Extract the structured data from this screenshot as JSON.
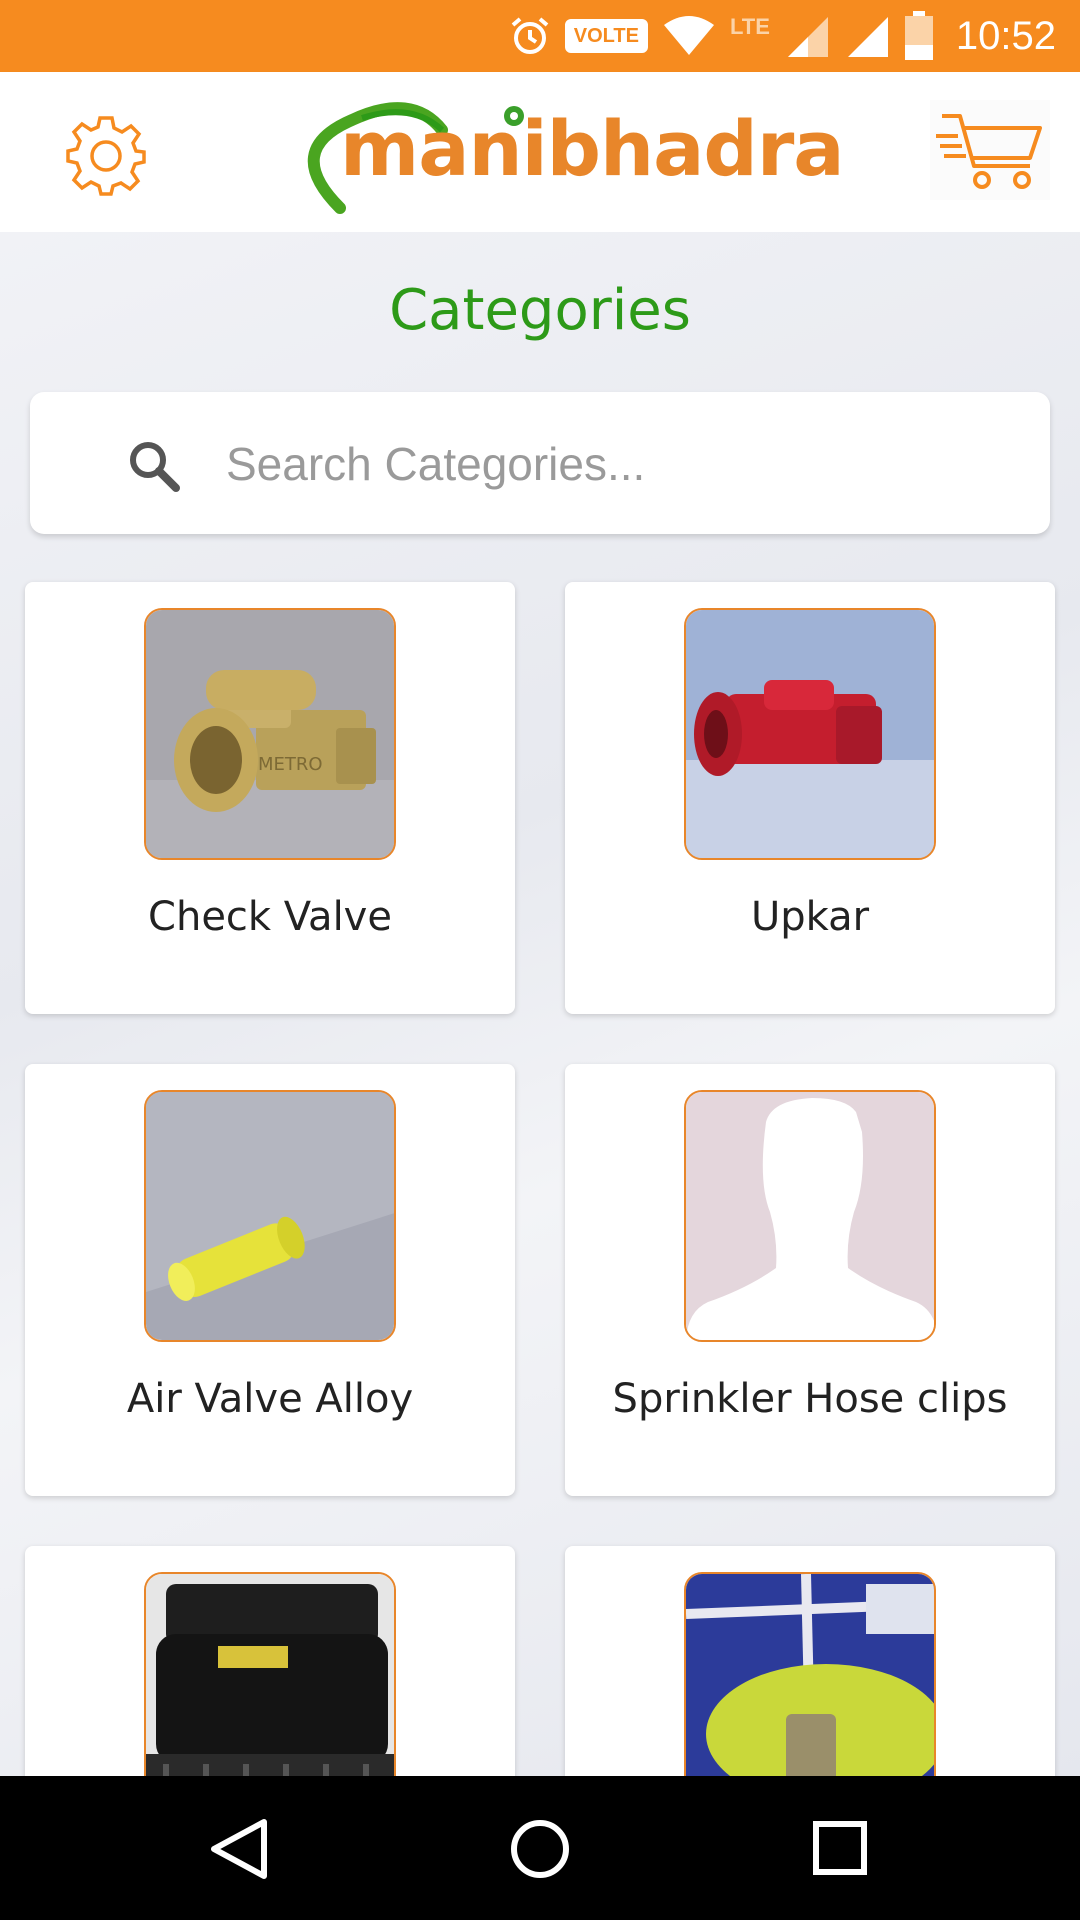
{
  "status_bar": {
    "time": "10:52",
    "volte": "VOLTE",
    "network": "LTE",
    "icons": [
      "alarm-icon",
      "wifi-icon",
      "signal-icon",
      "signal-icon",
      "battery-icon"
    ]
  },
  "header": {
    "logo_text": "manibhadra",
    "settings_icon": "gear-icon",
    "cart_icon": "cart-icon"
  },
  "page": {
    "title": "Categories"
  },
  "search": {
    "placeholder": "Search Categories...",
    "value": ""
  },
  "categories": [
    {
      "label": "Check Valve",
      "image": "brass-check-valve"
    },
    {
      "label": "Upkar",
      "image": "red-valve"
    },
    {
      "label": "Air Valve Alloy",
      "image": "yellow-air-valve"
    },
    {
      "label": "Sprinkler Hose clips",
      "image": "placeholder-person"
    },
    {
      "label": "",
      "image": "black-foot-valve"
    },
    {
      "label": "",
      "image": "blue-package"
    }
  ],
  "colors": {
    "brand_orange": "#f68b1f",
    "title_green": "#2d9a18",
    "thumb_border": "#e8862a"
  },
  "navbar": {
    "icons": [
      "back-icon",
      "home-icon",
      "recents-icon"
    ]
  }
}
